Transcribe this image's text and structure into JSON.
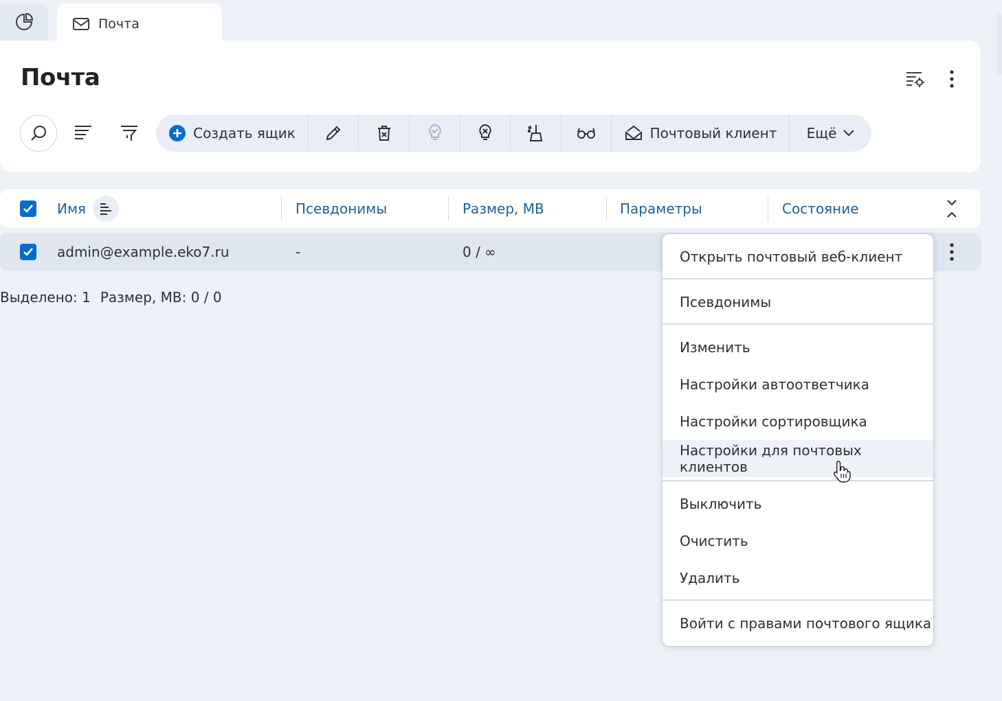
{
  "tabs": {
    "mail_label": "Почта"
  },
  "page": {
    "title": "Почта"
  },
  "toolbar": {
    "create_label": "Создать ящик",
    "mail_client_label": "Почтовый клиент",
    "more_label": "Ещё"
  },
  "table": {
    "columns": [
      "Имя",
      "Псевдонимы",
      "Размер, МB",
      "Параметры",
      "Состояние"
    ],
    "rows": [
      {
        "name": "admin@example.eko7.ru",
        "aliases": "-",
        "size": "0 / ∞"
      }
    ]
  },
  "status": {
    "selected": "Выделено: 1",
    "size": "Размер, МB: 0 / 0"
  },
  "menu": {
    "items": [
      "Открыть почтовый веб-клиент",
      "Псевдонимы",
      "Изменить",
      "Настройки автоответчика",
      "Настройки сортировщика",
      "Настройки для почтовых клиентов",
      "Выключить",
      "Очистить",
      "Удалить",
      "Войти с правами почтового ящика"
    ]
  },
  "colors": {
    "accent": "#0a6bc8",
    "header_text": "#1f5f95",
    "background": "#edf1f8"
  }
}
